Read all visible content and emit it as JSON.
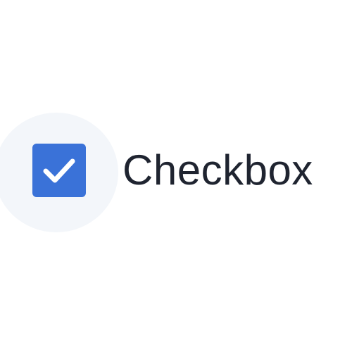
{
  "checkbox": {
    "label": "Checkbox",
    "checked": true,
    "check_icon": "checkmark-icon",
    "box_color": "#3a72d8",
    "check_color": "#ffffff",
    "halo_color": "#f3f6fa"
  }
}
